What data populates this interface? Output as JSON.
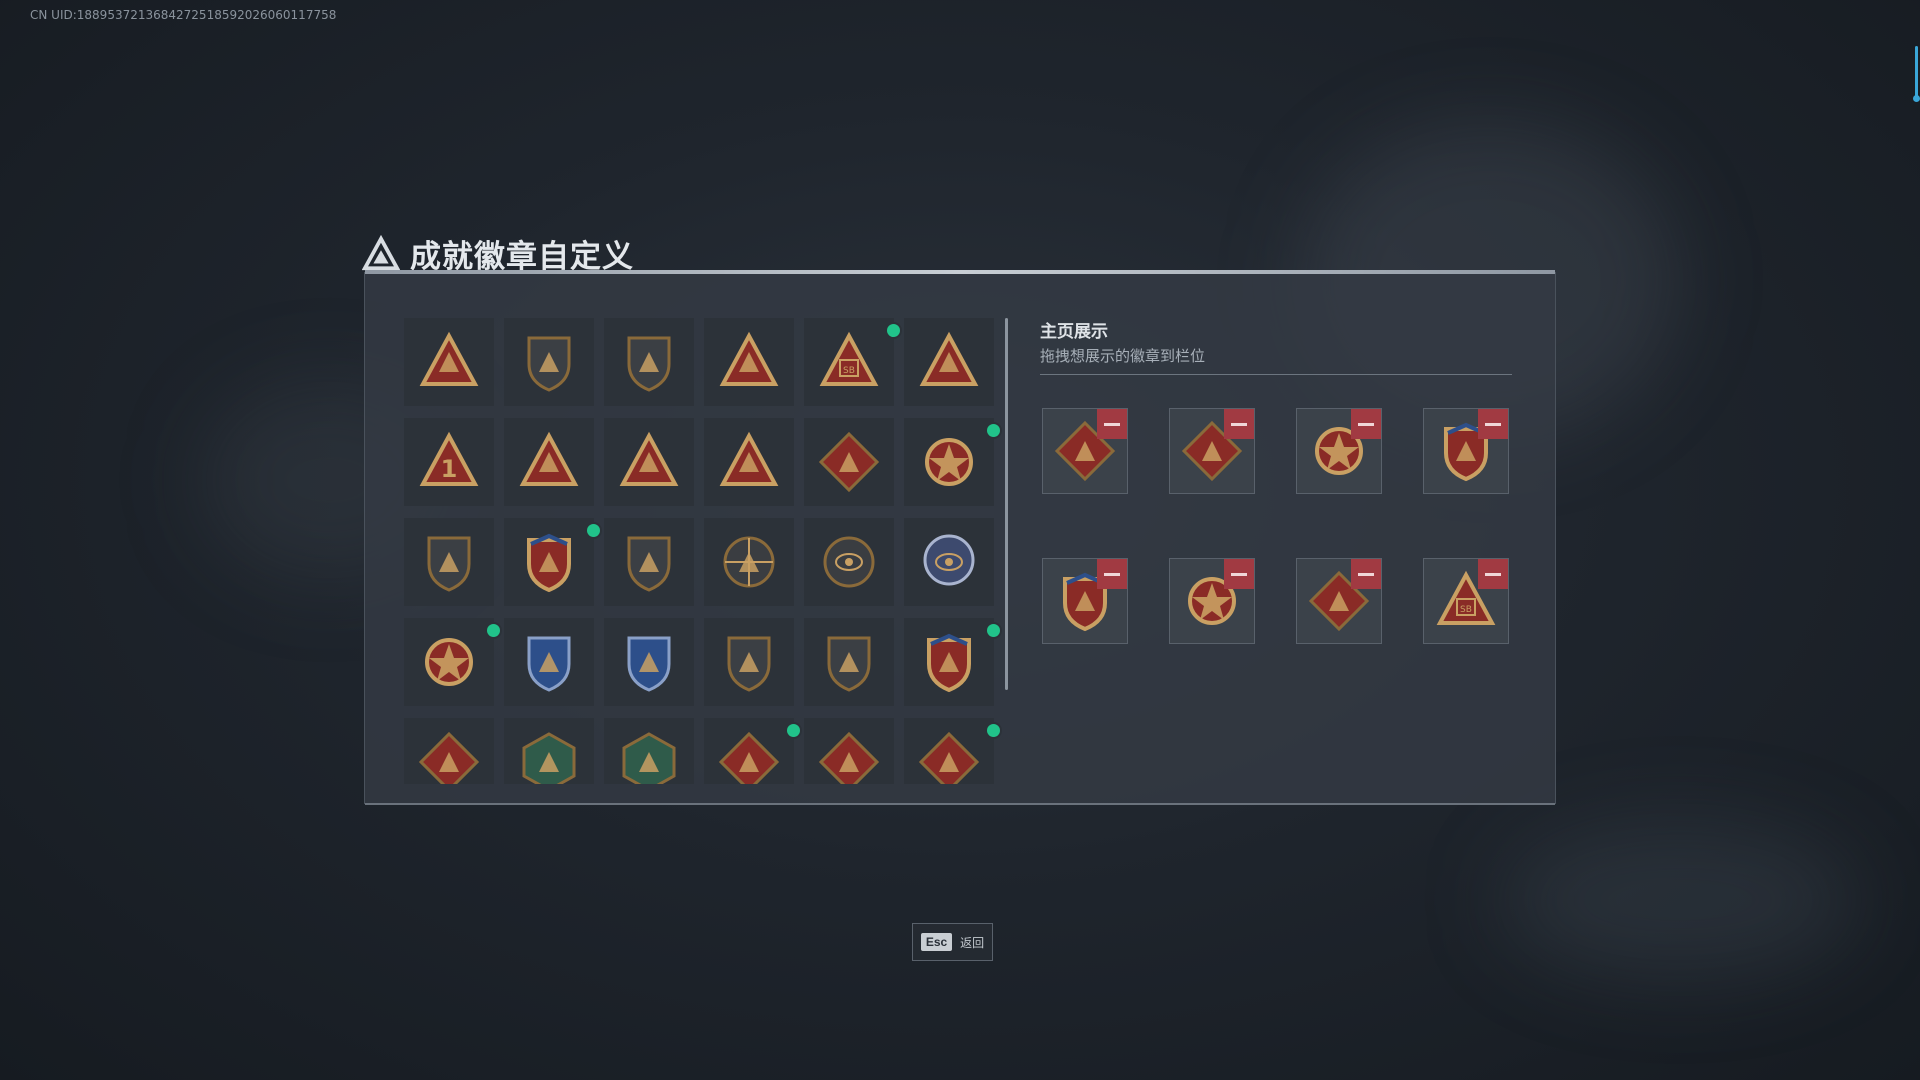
{
  "uid_text": "CN UID:1889537213684272518592026060117758",
  "title": "成就徽章自定义",
  "showcase": {
    "title": "主页展示",
    "subtitle": "拖拽想展示的徽章到栏位"
  },
  "esc": {
    "key": "Esc",
    "label": "返回"
  },
  "colors": {
    "gold": "#c9a063",
    "goldDark": "#8a6a3a",
    "red": "#8a2b26",
    "blue": "#2d4f8a",
    "green": "#21c38a",
    "removeRed": "#a13a42"
  },
  "badge_grid": [
    [
      {
        "icon": "shield-triangle-badge-icon",
        "new": false
      },
      {
        "icon": "helicopter-shield-badge-icon",
        "new": false
      },
      {
        "icon": "jet-shield-badge-icon",
        "new": false
      },
      {
        "icon": "rank-triangle-badge-icon",
        "new": false
      },
      {
        "icon": "sb-triangle-badge-icon",
        "new": true
      },
      {
        "icon": "wings-triangle-badge-icon",
        "new": false
      }
    ],
    [
      {
        "icon": "number-one-triangle-badge-icon",
        "new": false
      },
      {
        "icon": "soldier-triangle-badge-icon",
        "new": false
      },
      {
        "icon": "wreath-triangle-badge-icon",
        "new": false
      },
      {
        "icon": "squad-triangle-badge-icon",
        "new": false
      },
      {
        "icon": "rocket-diamond-badge-icon",
        "new": false
      },
      {
        "icon": "star-emblem-badge-icon",
        "new": true
      }
    ],
    [
      {
        "icon": "chevron-shield-badge-icon",
        "new": false
      },
      {
        "icon": "crest-shield-badge-icon",
        "new": true
      },
      {
        "icon": "gem-shield-badge-icon",
        "new": false
      },
      {
        "icon": "skull-crosshair-badge-icon",
        "new": false
      },
      {
        "icon": "eye-circle-badge-icon",
        "new": false
      },
      {
        "icon": "globe-shield-badge-icon",
        "new": false
      }
    ],
    [
      {
        "icon": "sunburst-emblem-badge-icon",
        "new": true
      },
      {
        "icon": "rifle-shield-blue-badge-icon",
        "new": false
      },
      {
        "icon": "rifle-shield-blue-badge-icon",
        "new": false
      },
      {
        "icon": "knife-shield-badge-icon",
        "new": false
      },
      {
        "icon": "pistol-shield-badge-icon",
        "new": false
      },
      {
        "icon": "anchor-shield-badge-icon",
        "new": true
      }
    ],
    [
      {
        "icon": "wolf-diamond-badge-icon",
        "new": false
      },
      {
        "icon": "eagle-hexagon-badge-icon",
        "new": false
      },
      {
        "icon": "jet-hexagon-badge-icon",
        "new": false
      },
      {
        "icon": "dragon-diamond-badge-icon",
        "new": true
      },
      {
        "icon": "runner-diamond-badge-icon",
        "new": false
      },
      {
        "icon": "backpack-diamond-badge-icon",
        "new": true
      }
    ]
  ],
  "showcase_slots": [
    {
      "icon": "backpack-diamond-badge-icon"
    },
    {
      "icon": "vest-diamond-badge-icon"
    },
    {
      "icon": "star-emblem-badge-icon"
    },
    {
      "icon": "crest-shield-badge-icon"
    },
    {
      "icon": "anchor-shield-badge-icon"
    },
    {
      "icon": "sunburst-emblem-badge-icon"
    },
    {
      "icon": "dragon-diamond-badge-icon"
    },
    {
      "icon": "sb-triangle-badge-icon"
    }
  ]
}
